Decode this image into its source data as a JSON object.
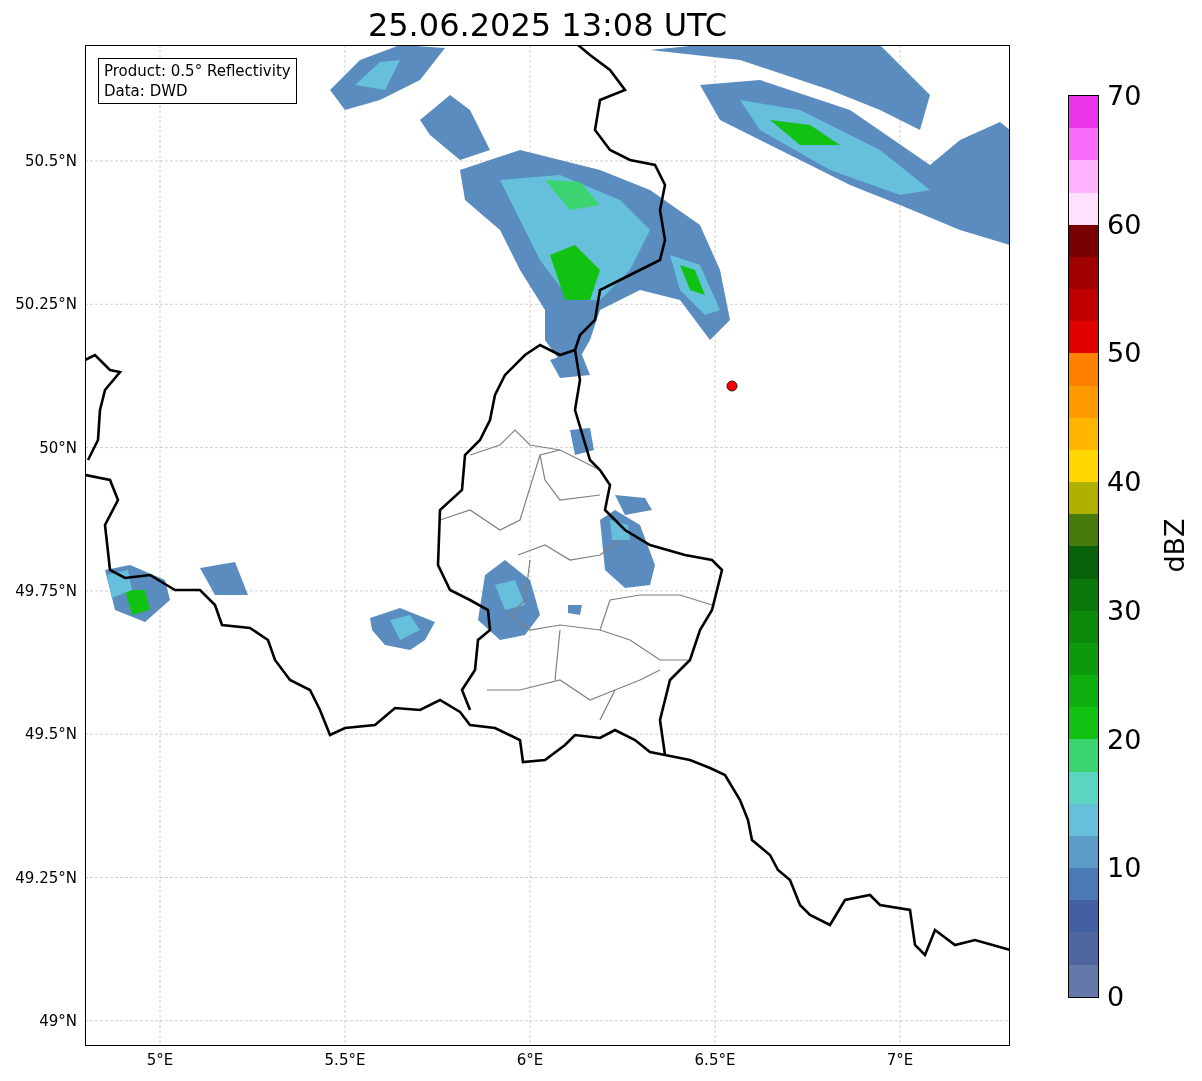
{
  "title": "25.06.2025 13:08 UTC",
  "info_box": [
    "Product: 0.5° Reflectivity",
    "Data: DWD"
  ],
  "x_ticks": [
    "5°E",
    "5.5°E",
    "6°E",
    "6.5°E",
    "7°E"
  ],
  "y_ticks": [
    "50.5°N",
    "50.25°N",
    "50°N",
    "49.75°N",
    "49.5°N",
    "49.25°N",
    "49°N"
  ],
  "colorbar": {
    "label": "dBZ",
    "ticks": [
      "70",
      "60",
      "50",
      "40",
      "30",
      "20",
      "10",
      "0"
    ],
    "levels": [
      {
        "color": "#e935e9"
      },
      {
        "color": "#fb6cfb"
      },
      {
        "color": "#ffb3ff"
      },
      {
        "color": "#ffe0ff"
      },
      {
        "color": "#780000"
      },
      {
        "color": "#a00000"
      },
      {
        "color": "#c00000"
      },
      {
        "color": "#e00000"
      },
      {
        "color": "#ff7f00"
      },
      {
        "color": "#ff9a00"
      },
      {
        "color": "#ffb600"
      },
      {
        "color": "#ffd700"
      },
      {
        "color": "#b0b000"
      },
      {
        "color": "#467a0a"
      },
      {
        "color": "#086008"
      },
      {
        "color": "#0a780a"
      },
      {
        "color": "#0b8a0b"
      },
      {
        "color": "#0c9a0c"
      },
      {
        "color": "#0eae0e"
      },
      {
        "color": "#12c212"
      },
      {
        "color": "#3cd470"
      },
      {
        "color": "#5cd6c0"
      },
      {
        "color": "#66c0dc"
      },
      {
        "color": "#5a9cc6"
      },
      {
        "color": "#4a7ab4"
      },
      {
        "color": "#4460a4"
      },
      {
        "color": "#5066a0"
      },
      {
        "color": "#6478aa"
      }
    ]
  }
}
